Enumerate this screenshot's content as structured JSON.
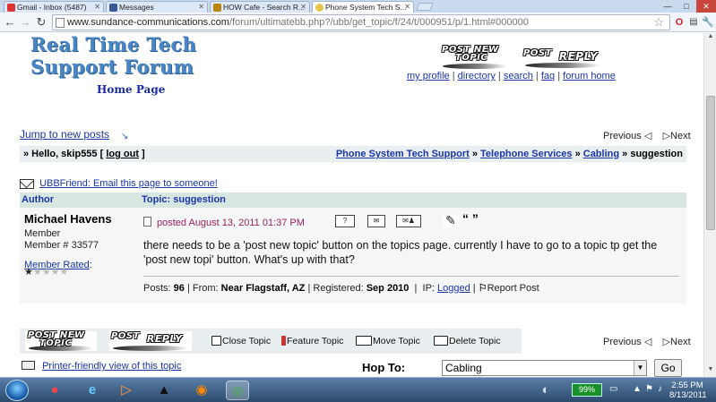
{
  "browser": {
    "tabs": [
      {
        "label": "Gmail - Inbox (5487)",
        "active": false
      },
      {
        "label": "Messages",
        "active": false
      },
      {
        "label": "HOW Cafe - Search R...",
        "active": false
      },
      {
        "label": "Phone System Tech S...",
        "active": true
      }
    ],
    "url_host": "www.sundance-communications.com",
    "url_path": "/forum/ultimatebb.php?/ubb/get_topic/f/24/t/000951/p/1.html#000000",
    "window_controls": [
      "—",
      "□",
      "✕"
    ]
  },
  "header": {
    "logo_line1": "Real Time Tech",
    "logo_line2": "Support Forum",
    "home_page": "Home Page",
    "post_new_topic": [
      "POST NEW",
      "TOPIC"
    ],
    "post_reply": [
      "POST",
      "REPLY"
    ],
    "links": [
      "my profile",
      "directory",
      "search",
      "faq",
      "forum home"
    ]
  },
  "nav": {
    "jump_to_new": "Jump to new posts",
    "previous": "Previous",
    "next": "Next",
    "hello_prefix": "» Hello, skip555 [",
    "logout": "log out",
    "hello_suffix": "]",
    "breadcrumbs": [
      "Phone System Tech Support",
      "Telephone Services",
      "Cabling"
    ],
    "current": "suggestion",
    "crumb_sep": " » "
  },
  "ubbfriend": "UBBFriend: Email this page to someone!",
  "table": {
    "col_author": "Author",
    "col_topic": "Topic: suggestion"
  },
  "post": {
    "author": "Michael Havens",
    "role": "Member",
    "member_no": "Member # 33577",
    "rated_label": "Member Rated",
    "rated_colon": ":",
    "rating": 1,
    "rating_max": 5,
    "posted": "posted August 13, 2011 01:37 PM",
    "quote_glyph": "“ ”",
    "body": "there needs to be a 'post new topic' button on the topics page. currently I have to go to a topic tp get the 'post new topi' button. What's up with that?",
    "posts_label": "Posts:",
    "posts_value": "96",
    "from_label": "From:",
    "from_value": "Near Flagstaff, AZ",
    "registered_label": "Registered:",
    "registered_value": "Sep 2010",
    "ip_label": "IP:",
    "ip_value": "Logged",
    "report": "Report Post"
  },
  "bottom": {
    "close_topic": "Close Topic",
    "feature_topic": "Feature Topic",
    "move_topic": "Move Topic",
    "delete_topic": "Delete Topic",
    "printer": "Printer-friendly view of this topic",
    "hop_to": "Hop To:",
    "hop_value": "Cabling",
    "go": "Go"
  },
  "taskbar": {
    "battery": "99%",
    "time": "2:55 PM",
    "date": "8/13/2011"
  }
}
